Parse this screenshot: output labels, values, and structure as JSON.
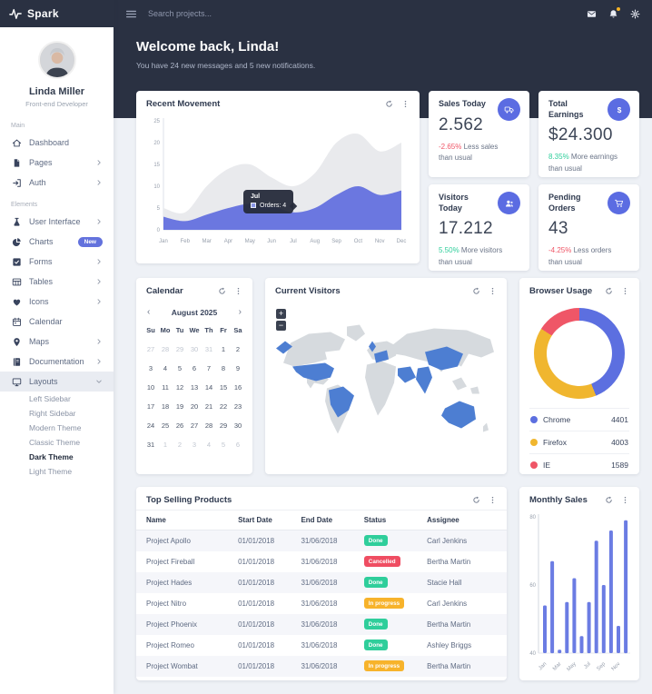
{
  "brand": {
    "name": "Spark",
    "logo_icon": "pulse-icon"
  },
  "theme": {
    "accent": "#5b6ce2",
    "dark": "#2a3142",
    "positive": "#2fce9b",
    "negative": "#ef5667",
    "warning": "#f5b225",
    "card_actions": [
      "refresh-icon",
      "kebab-icon"
    ]
  },
  "user": {
    "name": "Linda Miller",
    "role": "Front-end Developer"
  },
  "navbar": {
    "search_placeholder": "Search projects...",
    "menu_icon": "hamburger-icon",
    "icons": [
      {
        "name": "envelope-icon"
      },
      {
        "name": "bell-icon",
        "badge": true,
        "badge_color": "#f5b225"
      },
      {
        "name": "gear-icon"
      }
    ]
  },
  "sidebar": {
    "active_child": "Dark Theme",
    "sections": [
      {
        "header": "Main",
        "items": [
          {
            "label": "Dashboard",
            "icon": "home-icon"
          },
          {
            "label": "Pages",
            "icon": "file-icon",
            "chevron": "right"
          },
          {
            "label": "Auth",
            "icon": "login-icon",
            "chevron": "right"
          }
        ]
      },
      {
        "header": "Elements",
        "items": [
          {
            "label": "User Interface",
            "icon": "flask-icon",
            "chevron": "right"
          },
          {
            "label": "Charts",
            "icon": "pie-icon",
            "badge": "New"
          },
          {
            "label": "Forms",
            "icon": "check-icon",
            "chevron": "right"
          },
          {
            "label": "Tables",
            "icon": "table-icon",
            "chevron": "right"
          },
          {
            "label": "Icons",
            "icon": "heart-icon",
            "chevron": "right"
          },
          {
            "label": "Calendar",
            "icon": "calendar-icon"
          },
          {
            "label": "Maps",
            "icon": "pin-icon",
            "chevron": "right"
          },
          {
            "label": "Documentation",
            "icon": "book-icon",
            "chevron": "right"
          },
          {
            "label": "Layouts",
            "icon": "monitor-icon",
            "chevron": "down",
            "active": true,
            "children": [
              "Left Sidebar",
              "Right Sidebar",
              "Modern Theme",
              "Classic Theme",
              "Dark Theme",
              "Light Theme"
            ]
          }
        ]
      }
    ]
  },
  "welcome": {
    "title": "Welcome back, Linda!",
    "subtitle": "You have 24 new messages and 5 new notifications."
  },
  "stats": [
    {
      "title": "Sales Today",
      "icon": "truck-icon",
      "value": "2.562",
      "delta": "-2.65%",
      "delta_positive": false,
      "description": "Less sales than usual"
    },
    {
      "title": "Total Earnings",
      "icon": "dollar-icon",
      "value": "$24.300",
      "delta": "8.35%",
      "delta_positive": true,
      "description": "More earnings than usual"
    },
    {
      "title": "Visitors Today",
      "icon": "users-icon",
      "value": "17.212",
      "delta": "5.50%",
      "delta_positive": true,
      "description": "More visitors than usual"
    },
    {
      "title": "Pending Orders",
      "icon": "cart-icon",
      "value": "43",
      "delta": "-4.25%",
      "delta_positive": false,
      "description": "Less orders than usual"
    }
  ],
  "chart_data": [
    {
      "type": "area",
      "title": "Recent Movement",
      "x": [
        "Jan",
        "Feb",
        "Mar",
        "Apr",
        "May",
        "Jun",
        "Jul",
        "Aug",
        "Sep",
        "Oct",
        "Nov",
        "Dec"
      ],
      "series": [
        {
          "name": "Total",
          "color": "#e9eaed",
          "values": [
            5,
            4,
            10,
            14,
            15,
            12,
            10,
            13,
            20,
            22,
            18,
            20
          ]
        },
        {
          "name": "Orders",
          "color": "#6b77e0",
          "values": [
            3,
            2,
            3.5,
            5,
            6,
            5.5,
            4,
            5,
            8,
            10,
            8,
            9
          ]
        }
      ],
      "ylim": [
        0,
        25
      ],
      "yticks": [
        0,
        5,
        10,
        15,
        20,
        25
      ],
      "tooltip": {
        "label": "Jul",
        "series": "Orders",
        "value": 4
      }
    },
    {
      "type": "donut",
      "title": "Browser Usage",
      "segments": [
        {
          "label": "Chrome",
          "value": 4401,
          "color": "#5c6fe0"
        },
        {
          "label": "Firefox",
          "value": 4003,
          "color": "#f0b62f"
        },
        {
          "label": "IE",
          "value": 1589,
          "color": "#ef5667"
        }
      ],
      "legend_position": "bottom"
    },
    {
      "type": "bar",
      "title": "Monthly Sales",
      "categories": [
        "Jan",
        "Feb",
        "Mar",
        "Apr",
        "May",
        "Jun",
        "Jul",
        "Aug",
        "Sep",
        "Oct",
        "Nov",
        "Dec"
      ],
      "values": [
        54,
        67,
        41,
        55,
        62,
        45,
        55,
        73,
        60,
        76,
        48,
        79
      ],
      "ylim": [
        40,
        80
      ],
      "yticks": [
        40,
        60,
        80
      ],
      "xtick_labels": [
        "Jan",
        "Mar",
        "May",
        "Jul",
        "Sep",
        "Nov"
      ],
      "bar_color": "#6b7ce3"
    }
  ],
  "calendar": {
    "title": "Calendar",
    "prev": "‹",
    "next": "›",
    "month_label": "August 2025",
    "weekdays": [
      "Su",
      "Mo",
      "Tu",
      "We",
      "Th",
      "Fr",
      "Sa"
    ],
    "weeks": [
      [
        27,
        28,
        29,
        30,
        31,
        1,
        2
      ],
      [
        3,
        4,
        5,
        6,
        7,
        8,
        9
      ],
      [
        10,
        11,
        12,
        13,
        14,
        15,
        16
      ],
      [
        17,
        18,
        19,
        20,
        21,
        22,
        23
      ],
      [
        24,
        25,
        26,
        27,
        28,
        29,
        30
      ],
      [
        31,
        1,
        2,
        3,
        4,
        5,
        6
      ]
    ]
  },
  "visitors": {
    "title": "Current Visitors",
    "zoom_in": "+",
    "zoom_out": "−",
    "land_color": "#d6dade",
    "highlight_color": "#4d7ed2",
    "highlighted": [
      "United States",
      "Brazil",
      "United Kingdom",
      "France",
      "Saudi Arabia",
      "India",
      "China",
      "Australia"
    ]
  },
  "table": {
    "title": "Top Selling Products",
    "columns": [
      "Name",
      "Start Date",
      "End Date",
      "Status",
      "Assignee"
    ],
    "status_colors": {
      "Done": "#2fce9b",
      "Cancelled": "#ef4d62",
      "In progress": "#f7b32b"
    },
    "rows": [
      {
        "name": "Project Apollo",
        "start": "01/01/2018",
        "end": "31/06/2018",
        "status": "Done",
        "assignee": "Carl Jenkins"
      },
      {
        "name": "Project Fireball",
        "start": "01/01/2018",
        "end": "31/06/2018",
        "status": "Cancelled",
        "assignee": "Bertha Martin"
      },
      {
        "name": "Project Hades",
        "start": "01/01/2018",
        "end": "31/06/2018",
        "status": "Done",
        "assignee": "Stacie Hall"
      },
      {
        "name": "Project Nitro",
        "start": "01/01/2018",
        "end": "31/06/2018",
        "status": "In progress",
        "assignee": "Carl Jenkins"
      },
      {
        "name": "Project Phoenix",
        "start": "01/01/2018",
        "end": "31/06/2018",
        "status": "Done",
        "assignee": "Bertha Martin"
      },
      {
        "name": "Project Romeo",
        "start": "01/01/2018",
        "end": "31/06/2018",
        "status": "Done",
        "assignee": "Ashley Briggs"
      },
      {
        "name": "Project Wombat",
        "start": "01/01/2018",
        "end": "31/06/2018",
        "status": "In progress",
        "assignee": "Bertha Martin"
      }
    ]
  }
}
